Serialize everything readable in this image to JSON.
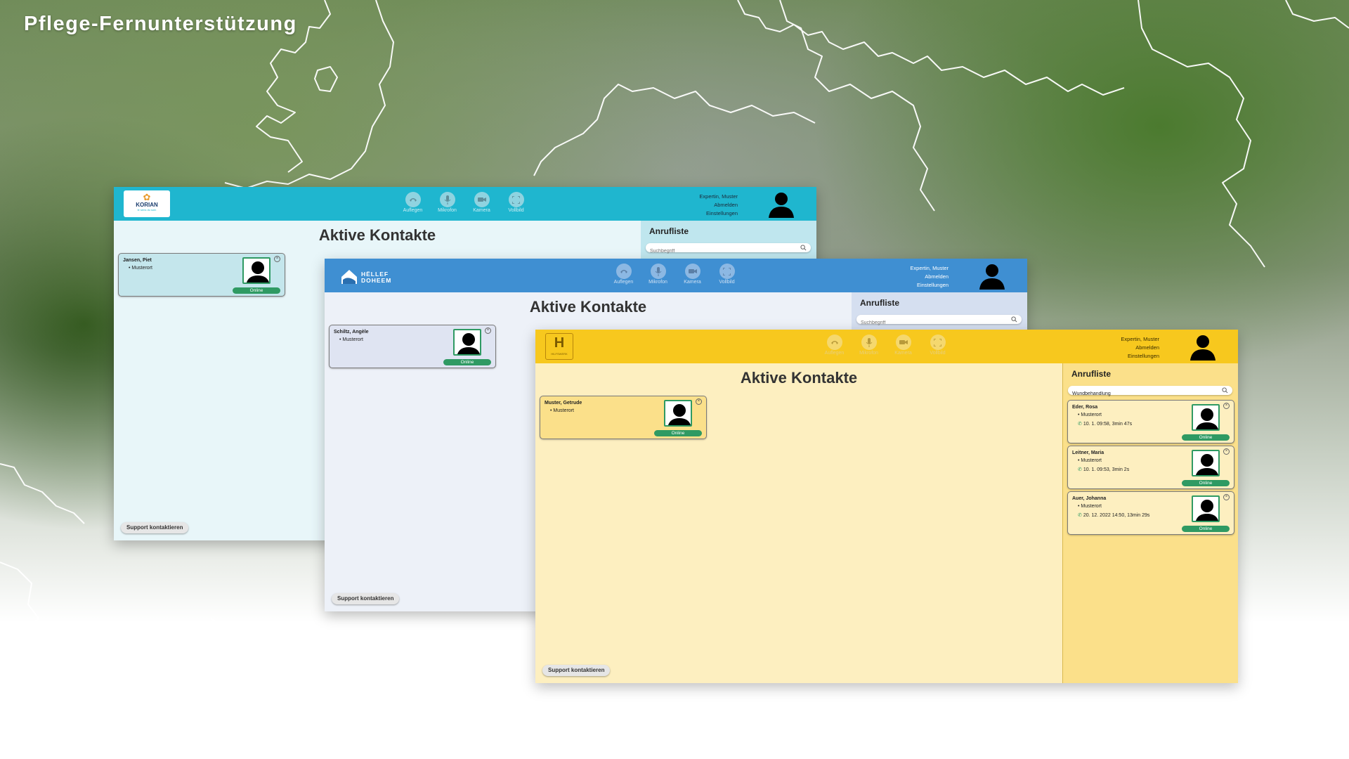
{
  "headline": "Pflege-Fernunterstützung",
  "windows": {
    "korian": {
      "logo": "KORIAN",
      "logo_tagline": "le sens du soin",
      "controls": [
        "Auflegen",
        "Mikrofon",
        "Kamera",
        "Vollbild"
      ],
      "user": {
        "name": "Expertin, Muster",
        "logout": "Abmelden",
        "settings": "Einstellungen"
      },
      "title": "Aktive Kontakte",
      "contact": {
        "name": "Jansen, Piet",
        "place": "Musterort",
        "status": "Online"
      },
      "sidebar_title": "Anrufliste",
      "search_placeholder": "Suchbegriff",
      "support": "Support kontaktieren"
    },
    "hellef": {
      "logo": "HËLLEF DOHEEM",
      "controls": [
        "Auflegen",
        "Mikrofon",
        "Kamera",
        "Vollbild"
      ],
      "user": {
        "name": "Expertin, Muster",
        "logout": "Abmelden",
        "settings": "Einstellungen"
      },
      "title": "Aktive Kontakte",
      "contact": {
        "name": "Schiltz, Angèle",
        "place": "Musterort",
        "status": "Online"
      },
      "sidebar_title": "Anrufliste",
      "search_placeholder": "Suchbegriff",
      "support": "Support kontaktieren"
    },
    "hilfswerk": {
      "logo": "HILFSWERK",
      "controls": [
        "Auflegen",
        "Mikrofon",
        "Kamera",
        "Vollbild"
      ],
      "user": {
        "name": "Expertin, Muster",
        "logout": "Abmelden",
        "settings": "Einstellungen"
      },
      "title": "Aktive Kontakte",
      "contact": {
        "name": "Muster, Getrude",
        "place": "Musterort",
        "status": "Online"
      },
      "sidebar_title": "Anrufliste",
      "search_value": "Wundbehandlung",
      "calls": [
        {
          "name": "Eder, Rosa",
          "place": "Musterort",
          "call": "10. 1. 09:58, 3min 47s",
          "status": "Online"
        },
        {
          "name": "Leitner, Maria",
          "place": "Musterort",
          "call": "10. 1. 09:53, 3min 2s",
          "status": "Online"
        },
        {
          "name": "Auer, Johanna",
          "place": "Musterort",
          "call": "20. 12. 2022 14:50, 13min 29s",
          "status": "Online"
        }
      ],
      "support": "Support kontaktieren"
    }
  },
  "colors": {
    "korian_bar": "#1fb6cf",
    "korian_bg": "#e8f6f9",
    "hellef_bar": "#3f8fd2",
    "hellef_bg": "#edf1f8",
    "hilfswerk_bar": "#f7c81e",
    "hilfswerk_bg": "#fdefc0",
    "online": "#2f9a63"
  }
}
